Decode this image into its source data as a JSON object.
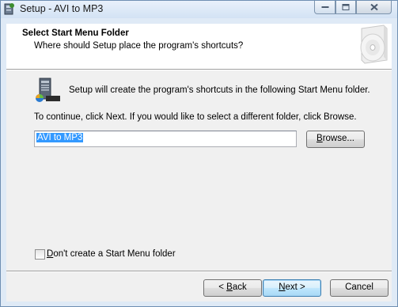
{
  "window": {
    "title": "Setup - AVI to MP3"
  },
  "header": {
    "title": "Select Start Menu Folder",
    "subtitle": "Where should Setup place the program's shortcuts?"
  },
  "main": {
    "info_text": "Setup will create the program's shortcuts in the following Start Menu folder.",
    "continue_text": "To continue, click Next. If you would like to select a different folder, click Browse.",
    "folder_value": "AVI to MP3",
    "browse_label_u": "B",
    "browse_label_rest": "rowse...",
    "checkbox_label_u": "D",
    "checkbox_label_rest": "on't create a Start Menu folder",
    "checkbox_checked": false
  },
  "footer": {
    "back_prefix": "< ",
    "back_u": "B",
    "back_rest": "ack",
    "next_u": "N",
    "next_rest": "ext >",
    "cancel_label": "Cancel"
  }
}
